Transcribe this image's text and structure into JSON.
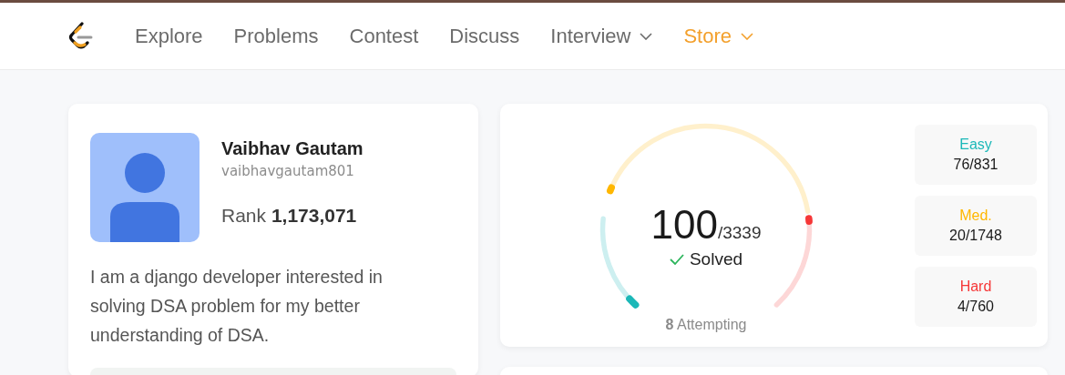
{
  "nav": {
    "items": [
      {
        "label": "Explore",
        "dropdown": false,
        "selected": false
      },
      {
        "label": "Problems",
        "dropdown": false,
        "selected": false
      },
      {
        "label": "Contest",
        "dropdown": false,
        "selected": false
      },
      {
        "label": "Discuss",
        "dropdown": false,
        "selected": false
      },
      {
        "label": "Interview",
        "dropdown": true,
        "selected": false
      },
      {
        "label": "Store",
        "dropdown": true,
        "selected": true
      }
    ]
  },
  "profile": {
    "name": "Vaibhav Gautam",
    "username": "vaibhavgautam801",
    "rank_label": "Rank",
    "rank": "1,173,071",
    "bio": "I am a django developer interested in solving DSA problem for my better understanding of DSA."
  },
  "progress": {
    "solved": "100",
    "total": "/3339",
    "solved_label": "Solved",
    "attempting_count": "8",
    "attempting_label": "Attempting",
    "gauge": [
      {
        "kind": "easy",
        "level": 0.09,
        "color": "#1cb8b8"
      },
      {
        "kind": "medium",
        "level": 0.012,
        "color": "#ffb700"
      },
      {
        "kind": "hard",
        "level": 0.02,
        "color": "#f63737"
      }
    ],
    "difficulties": [
      {
        "label": "Easy",
        "count": "76/831",
        "color": "#1cb8b8"
      },
      {
        "label": "Med.",
        "count": "20/1748",
        "color": "#ffb700"
      },
      {
        "label": "Hard",
        "count": "4/760",
        "color": "#f63737"
      }
    ]
  }
}
